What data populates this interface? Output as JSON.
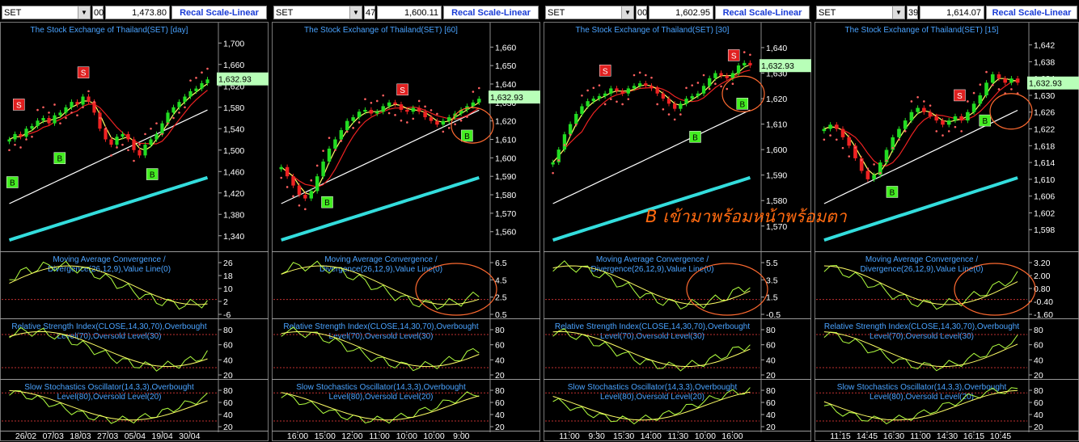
{
  "annotation": "B เข้ามาพร้อมหน้าพร้อมตา",
  "recal_label": "Recal Scale-Linear",
  "colors": {
    "background": "#000000",
    "axis_text": "#ffffff",
    "title_text": "#4aa3ff",
    "candle_up": "#22dd22",
    "candle_down": "#ee2222",
    "ma_fast": "#ffff66",
    "ma_mid": "#ee2222",
    "ma_slow": "#ffffff",
    "ma_long": "#33dddd",
    "sar_dots": "#ff6060",
    "signal_line": "#ffff66",
    "value_line": "#b0ff40",
    "price_label_bg": "#b8ffb8",
    "circle": "#ff6a30"
  },
  "panels": [
    {
      "symbol": "SET",
      "field_a": "00",
      "field_b": "1,473.80",
      "title": "The Stock Exchange of Thailand(SET) [day]",
      "last_price": "1,632.93",
      "price_ticks": [
        "1,700",
        "1,660",
        "1,620",
        "1,580",
        "1,540",
        "1,500",
        "1,460",
        "1,420",
        "1,380",
        "1,340"
      ],
      "price_range": [
        1320,
        1720
      ],
      "macd_title": [
        "Moving Average Convergence /",
        "Divergence(26,12,9),Value Line(0)"
      ],
      "macd_ticks": [
        "26",
        "18",
        "10",
        "2",
        "-6"
      ],
      "rsi_title": [
        "Relative Strength Index(CLOSE,14,30,70),Overbought",
        "Level(70),Oversold Level(30)"
      ],
      "rsi_ticks": [
        "80",
        "60",
        "40",
        "20"
      ],
      "sto_title": [
        "Slow Stochastics Oscillator(14,3,3),Overbought",
        "Level(80),Oversold Level(20)"
      ],
      "sto_ticks": [
        "80",
        "60",
        "40",
        "20"
      ],
      "time_labels": [
        "26/02",
        "07/03",
        "18/03",
        "27/03",
        "05/04",
        "19/04",
        "30/04"
      ],
      "signals": [
        {
          "label": "S",
          "x": 0.08,
          "price": 1585
        },
        {
          "label": "S",
          "x": 0.38,
          "price": 1645
        },
        {
          "label": "B",
          "x": 0.05,
          "price": 1440
        },
        {
          "label": "B",
          "x": 0.27,
          "price": 1485
        },
        {
          "label": "B",
          "x": 0.7,
          "price": 1455
        }
      ],
      "close": [
        1520,
        1530,
        1525,
        1540,
        1545,
        1555,
        1560,
        1550,
        1565,
        1570,
        1580,
        1590,
        1585,
        1600,
        1590,
        1570,
        1540,
        1520,
        1510,
        1525,
        1530,
        1520,
        1500,
        1490,
        1510,
        1520,
        1530,
        1550,
        1570,
        1580,
        1590,
        1600,
        1610,
        1615,
        1625,
        1632
      ]
    },
    {
      "symbol": "SET",
      "field_a": "47",
      "field_b": "1,600.11",
      "title": "The Stock Exchange of Thailand(SET) [60]",
      "last_price": "1,632.93",
      "price_ticks": [
        "1,660",
        "1,650",
        "1,640",
        "1,630",
        "1,620",
        "1,610",
        "1,600",
        "1,590",
        "1,580",
        "1,570",
        "1,560"
      ],
      "price_range": [
        1552,
        1668
      ],
      "macd_title": [
        "Moving Average Convergence /",
        "Divergence(26,12,9),Value Line(0)"
      ],
      "macd_ticks": [
        "6.5",
        "4.5",
        "2.5",
        "0.5"
      ],
      "rsi_title": [
        "Relative Strength Index(CLOSE,14,30,70),Overbought",
        "Level(70),Oversold Level(30)"
      ],
      "rsi_ticks": [
        "80",
        "60",
        "40",
        "20"
      ],
      "sto_title": [
        "Slow Stochastics Oscillator(14,3,3),Overbought",
        "Level(80),Oversold Level(20)"
      ],
      "sto_ticks": [
        "80",
        "60",
        "40",
        "20"
      ],
      "time_labels": [
        "16:00",
        "15:00",
        "12:00",
        "11:00",
        "10:00",
        "10:00",
        "9:00"
      ],
      "signals": [
        {
          "label": "S",
          "x": 0.6,
          "price": 1637
        },
        {
          "label": "B",
          "x": 0.25,
          "price": 1576
        },
        {
          "label": "B",
          "x": 0.9,
          "price": 1612
        }
      ],
      "close": [
        1595,
        1590,
        1585,
        1580,
        1578,
        1582,
        1590,
        1598,
        1605,
        1610,
        1615,
        1620,
        1622,
        1625,
        1626,
        1624,
        1625,
        1628,
        1630,
        1629,
        1626,
        1625,
        1627,
        1625,
        1622,
        1620,
        1618,
        1620,
        1622,
        1624,
        1626,
        1628,
        1630,
        1632
      ]
    },
    {
      "symbol": "SET",
      "field_a": "00",
      "field_b": "1,602.95",
      "title": "The Stock Exchange of Thailand(SET) [30]",
      "last_price": "1,632.93",
      "price_ticks": [
        "1,640",
        "1,630",
        "1,620",
        "1,610",
        "1,600",
        "1,590",
        "1,580",
        "1,570"
      ],
      "price_range": [
        1562,
        1646
      ],
      "macd_title": [
        "Moving Average Convergence /",
        "Divergence(26,12,9),Value Line(0)"
      ],
      "macd_ticks": [
        "5.5",
        "3.5",
        "1.5",
        "-0.5"
      ],
      "rsi_title": [
        "Relative Strength Index(CLOSE,14,30,70),Overbought",
        "Level(70),Oversold Level(30)"
      ],
      "rsi_ticks": [
        "80",
        "60",
        "40",
        "20"
      ],
      "sto_title": [
        "Slow Stochastics Oscillator(14,3,3),Overbought",
        "Level(80),Oversold Level(20)"
      ],
      "sto_ticks": [
        "80",
        "60",
        "40",
        "20"
      ],
      "time_labels": [
        "11:00",
        "9:30",
        "15:30",
        "14:00",
        "11:30",
        "10:00",
        "16:00"
      ],
      "signals": [
        {
          "label": "S",
          "x": 0.28,
          "price": 1631
        },
        {
          "label": "S",
          "x": 0.88,
          "price": 1637
        },
        {
          "label": "B",
          "x": 0.7,
          "price": 1605
        },
        {
          "label": "B",
          "x": 0.92,
          "price": 1618
        }
      ],
      "close": [
        1595,
        1600,
        1606,
        1610,
        1614,
        1617,
        1619,
        1620,
        1621,
        1622,
        1624,
        1623,
        1622,
        1624,
        1625,
        1626,
        1625,
        1624,
        1622,
        1620,
        1618,
        1616,
        1618,
        1620,
        1621,
        1622,
        1625,
        1628,
        1630,
        1629,
        1628,
        1630,
        1633,
        1634,
        1633
      ]
    },
    {
      "symbol": "SET",
      "field_a": "39",
      "field_b": "1,614.07",
      "title": "The Stock Exchange of Thailand(SET) [15]",
      "last_price": "1,632.93",
      "price_ticks": [
        "1,642",
        "1,638",
        "1,634",
        "1,630",
        "1,626",
        "1,622",
        "1,618",
        "1,614",
        "1,610",
        "1,606",
        "1,602",
        "1,598"
      ],
      "price_range": [
        1594,
        1645
      ],
      "macd_title": [
        "Moving Average Convergence /",
        "Divergence(26,12,9),Value Line(0)"
      ],
      "macd_ticks": [
        "3.20",
        "2.00",
        "0.80",
        "-0.40",
        "-1.60"
      ],
      "rsi_title": [
        "Relative Strength Index(CLOSE,14,30,70),Overbought",
        "Level(70),Oversold Level(30)"
      ],
      "rsi_ticks": [
        "80",
        "60",
        "40",
        "20"
      ],
      "sto_title": [
        "Slow Stochastics Oscillator(14,3,3),Overbought",
        "Level(80),Oversold Level(20)"
      ],
      "sto_ticks": [
        "80",
        "60",
        "40",
        "20"
      ],
      "time_labels": [
        "11:15",
        "14:45",
        "16:30",
        "11:00",
        "14:30",
        "16:15",
        "10:45"
      ],
      "signals": [
        {
          "label": "S",
          "x": 0.68,
          "price": 1630
        },
        {
          "label": "B",
          "x": 0.36,
          "price": 1607
        },
        {
          "label": "B",
          "x": 0.8,
          "price": 1624
        }
      ],
      "close": [
        1622,
        1623,
        1622,
        1620,
        1618,
        1615,
        1612,
        1610,
        1611,
        1614,
        1617,
        1620,
        1622,
        1624,
        1626,
        1627,
        1626,
        1625,
        1624,
        1623,
        1624,
        1625,
        1624,
        1626,
        1628,
        1630,
        1633,
        1635,
        1634,
        1633,
        1634,
        1633
      ]
    }
  ],
  "chart_data": [
    {
      "type": "line",
      "title": "The Stock Exchange of Thailand(SET) [day]",
      "x": [
        "26/02",
        "07/03",
        "18/03",
        "27/03",
        "05/04",
        "19/04",
        "30/04"
      ],
      "ylim": [
        1340,
        1700
      ],
      "series": [
        {
          "values": [
            1520,
            1585,
            1600,
            1510,
            1500,
            1580,
            1632
          ]
        }
      ]
    },
    {
      "type": "line",
      "title": "The Stock Exchange of Thailand(SET) [60]",
      "x": [
        "16:00",
        "15:00",
        "12:00",
        "11:00",
        "10:00",
        "10:00",
        "9:00"
      ],
      "ylim": [
        1560,
        1660
      ],
      "series": [
        {
          "values": [
            1595,
            1580,
            1615,
            1626,
            1625,
            1618,
            1632
          ]
        }
      ]
    },
    {
      "type": "line",
      "title": "The Stock Exchange of Thailand(SET) [30]",
      "x": [
        "11:00",
        "9:30",
        "15:30",
        "14:00",
        "11:30",
        "10:00",
        "16:00"
      ],
      "ylim": [
        1570,
        1640
      ],
      "series": [
        {
          "values": [
            1595,
            1619,
            1624,
            1625,
            1618,
            1628,
            1633
          ]
        }
      ]
    },
    {
      "type": "line",
      "title": "The Stock Exchange of Thailand(SET) [15]",
      "x": [
        "11:15",
        "14:45",
        "16:30",
        "11:00",
        "14:30",
        "16:15",
        "10:45"
      ],
      "ylim": [
        1598,
        1642
      ],
      "series": [
        {
          "values": [
            1622,
            1612,
            1620,
            1627,
            1624,
            1630,
            1633
          ]
        }
      ]
    }
  ]
}
